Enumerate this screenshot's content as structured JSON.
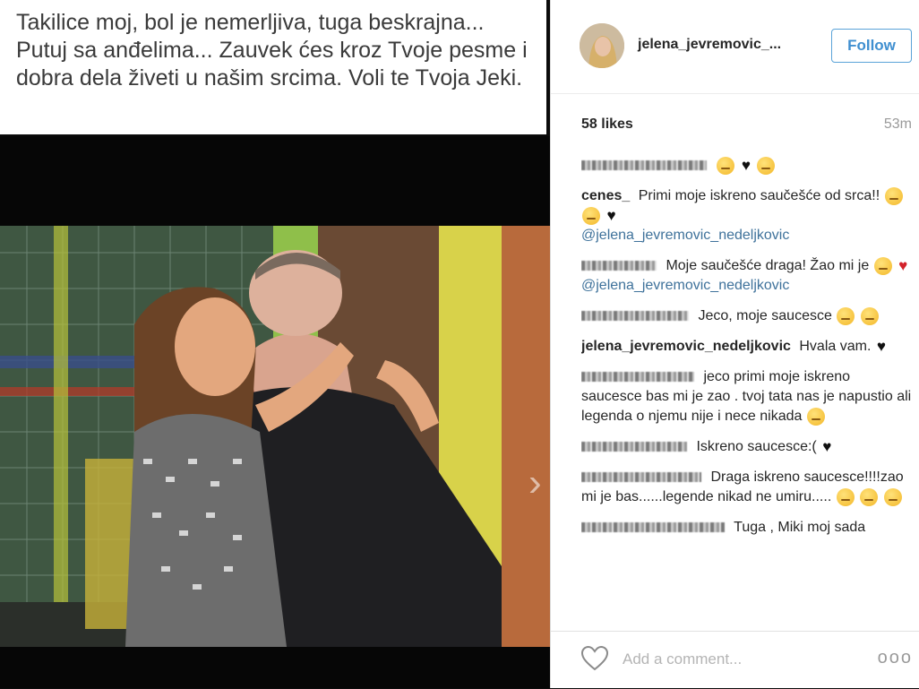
{
  "caption": {
    "text": "Takilice moj, bol je nemerljiva, tuga beskrajna... Putuj sa anđelima... Zauvek ćes kroz Tvoje pesme i dobra dela živeti u našim srcima. Voli te Tvoja Jeki."
  },
  "post": {
    "username": "jelena_jevremovic_...",
    "follow_label": "Follow",
    "likes": "58 likes",
    "time": "53m"
  },
  "comments": [
    {
      "author": "",
      "text": ""
    },
    {
      "author": "cenes_",
      "text": "Primi moje iskreno saučešće od srca!!",
      "mention": "@jelena_jevremovic_nedeljkovic"
    },
    {
      "author": "",
      "text": "Moje saučešće draga! Žao mi je",
      "mention": "@jelena_jevremovic_nedeljkovic"
    },
    {
      "author": "",
      "text": "Jeco, moje saucesce"
    },
    {
      "author": "jelena_jevremovic_nedeljkovic",
      "text": "Hvala vam."
    },
    {
      "author": "",
      "text": "jeco primi moje iskreno saucesce bas mi je zao . tvoj tata nas je napustio ali legenda o njemu nije i nece nikada"
    },
    {
      "author": "",
      "text": "Iskreno saucesce:("
    },
    {
      "author": "",
      "text": "Draga iskreno saucesce!!!!zao mi je bas......legende nikad ne umiru....."
    },
    {
      "author": "",
      "text": "Tuga , Miki moj sada"
    }
  ],
  "footer": {
    "placeholder": "Add a comment...",
    "more": "ooo"
  },
  "icons": {
    "like": "heart-outline-icon",
    "more": "more-options-icon",
    "next": "chevron-right-icon"
  }
}
